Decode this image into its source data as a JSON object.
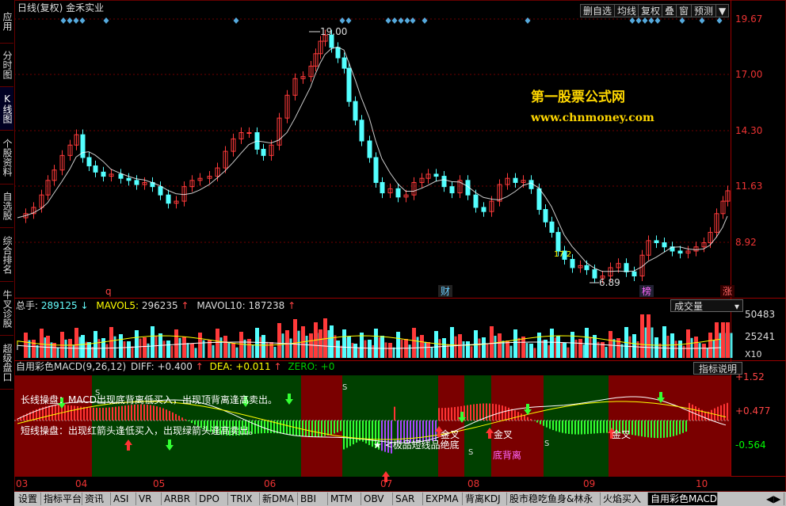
{
  "left_nav": [
    {
      "label": "应用",
      "active": false
    },
    {
      "label": "分时图",
      "active": false
    },
    {
      "label": "K线图",
      "active": true
    },
    {
      "label": "个股资料",
      "active": false
    },
    {
      "label": "自选股",
      "active": false
    },
    {
      "label": "综合排名",
      "active": false
    },
    {
      "label": "牛叉诊股",
      "active": false
    },
    {
      "label": "超级盘口",
      "active": false
    }
  ],
  "header": {
    "title": "日线(复权)  金禾实业"
  },
  "toolbar": {
    "del_fav": "删自选",
    "ma": "均线",
    "fuquan": "复权",
    "overlay": "叠",
    "window": "窗",
    "forecast": "预测",
    "menu": "▼"
  },
  "watermark": {
    "cn": "第一股票公式网",
    "url": "www.chnmoney.com"
  },
  "price_axis": [
    "19.67",
    "17.00",
    "14.30",
    "11.63",
    "8.92"
  ],
  "annotations": {
    "high": "19.00",
    "low": "6.89",
    "low_tag": "17 2",
    "mark_q": "q",
    "mark_cai": "财",
    "mark_bang": "榜",
    "mark_zhang": "涨"
  },
  "volume_legend": {
    "label_total": "总手:",
    "total": "289125",
    "label_ma5": "MAVOL5:",
    "ma5": "296235",
    "label_ma10": "MAVOL10:",
    "ma10": "187238",
    "arrow_down": "↓",
    "arrow_up": "↑"
  },
  "volume_axis": [
    "50483",
    "25241",
    "X10"
  ],
  "volume_dropdown": "成交量",
  "macd_legend": {
    "name": "自用彩色MACD(9,26,12)",
    "diff": "DIFF: +0.400",
    "dea": "DEA: +0.011",
    "zero": "ZERO: +0"
  },
  "macd_button": "指标说明",
  "macd_axis": [
    "+1.52",
    "+0.477",
    "-0.564"
  ],
  "macd_text": {
    "long": "长线操盘：MACD出现底背离低买入，出现顶背离逢高卖出。",
    "short": "短线操盘：出现红箭头逢低买入，出现绿箭头逢高卖出。",
    "jincha1": "金叉",
    "jincha2": "金叉",
    "jincha3": "金叉",
    "dibeili": "底背离",
    "bottom_text": "★ <极品短线品绝底",
    "s1": "S",
    "s2": "S",
    "s3": "S",
    "s4": "S"
  },
  "date_axis": [
    "03",
    "04",
    "05",
    "06",
    "07",
    "08",
    "09",
    "10"
  ],
  "tabs": [
    "设置",
    "指标平台",
    "资讯",
    "ASI",
    "VR",
    "ARBR",
    "DPO",
    "TRIX",
    "新DMA",
    "BBI",
    "MTM",
    "OBV",
    "SAR",
    "EXPMA",
    "背离KDJ",
    "股市稳吃鱼身&林永",
    "火焰买入",
    "自用彩色MACD"
  ],
  "active_tab": "自用彩色MACD",
  "colors": {
    "up": "#ff3a3a",
    "down": "#54ffff",
    "grid": "#700000",
    "bull_bg": "#7a0000",
    "bear_bg": "#004000",
    "watermark": "#ffd700"
  }
}
